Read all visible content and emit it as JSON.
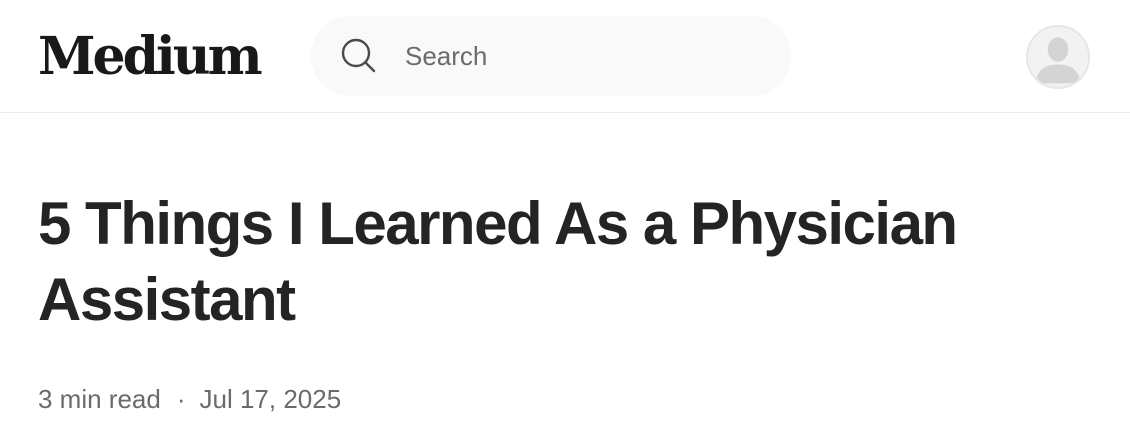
{
  "header": {
    "logo": "Medium",
    "search": {
      "placeholder": "Search",
      "value": "",
      "icon": "search-icon"
    },
    "avatar": {
      "icon": "user-placeholder-icon"
    }
  },
  "article": {
    "title": "5 Things I Learned As a Physician Assistant",
    "read_time": "3 min read",
    "separator": "·",
    "date": "Jul 17, 2025"
  },
  "colors": {
    "text": "#242424",
    "muted": "#6b6b6b",
    "search_bg": "#f9f9f9",
    "divider": "#ececec"
  }
}
